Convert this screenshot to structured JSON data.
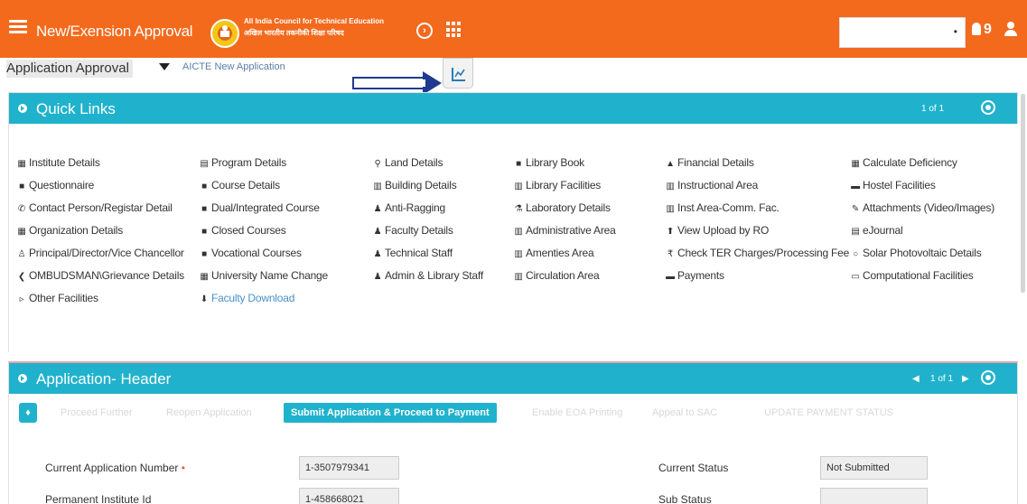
{
  "header": {
    "app_title": "New/Exension Approval",
    "org_name_en": "All India Council for Technical Education",
    "org_name_hi": "अखिल भारतीय तकनीकी शिक्षा परिषद",
    "notification_count": "9",
    "brand_color": "#f36a1d",
    "icons": [
      "menu-icon",
      "logo",
      "circle-arrow-icon",
      "apps-grid-icon",
      "bell-icon",
      "user-icon"
    ]
  },
  "breadcrumb": {
    "main": "Application Approval",
    "sub": "AICTE New Application"
  },
  "quick_links": {
    "title": "Quick Links",
    "pager": "1 of 1",
    "accent_color": "#20b2cc",
    "columns": [
      [
        {
          "label": "Institute Details",
          "icon": "▦"
        },
        {
          "label": "Questionnaire",
          "icon": "■"
        },
        {
          "label": "Contact Person/Registar Detail",
          "icon": "✆"
        },
        {
          "label": "Organization Details",
          "icon": "▦"
        },
        {
          "label": "Principal/Director/Vice Chancellor",
          "icon": "♙"
        },
        {
          "label": "OMBUDSMAN\\Grievance Details",
          "icon": "❮"
        },
        {
          "label": "Other Facilities",
          "icon": "▹"
        }
      ],
      [
        {
          "label": "Program Details",
          "icon": "▤"
        },
        {
          "label": "Course Details",
          "icon": "■"
        },
        {
          "label": "Dual/Integrated Course",
          "icon": "■"
        },
        {
          "label": "Closed Courses",
          "icon": "■"
        },
        {
          "label": "Vocational Courses",
          "icon": "■"
        },
        {
          "label": "University Name Change",
          "icon": "▦"
        },
        {
          "label": "Faculty Download",
          "icon": "⬇",
          "link": true
        }
      ],
      [
        {
          "label": "Land Details",
          "icon": "⚲"
        },
        {
          "label": "Building Details",
          "icon": "▥"
        },
        {
          "label": "Anti-Ragging",
          "icon": "♟"
        },
        {
          "label": "Faculty Details",
          "icon": "♟"
        },
        {
          "label": "Technical Staff",
          "icon": "♟"
        },
        {
          "label": "Admin & Library Staff",
          "icon": "♟"
        }
      ],
      [
        {
          "label": "Library Book",
          "icon": "■"
        },
        {
          "label": "Library Facilities",
          "icon": "▥"
        },
        {
          "label": "Laboratory Details",
          "icon": "⚗"
        },
        {
          "label": "Administrative Area",
          "icon": "▥"
        },
        {
          "label": "Amenties Area",
          "icon": "▥"
        },
        {
          "label": "Circulation Area",
          "icon": "▥"
        }
      ],
      [
        {
          "label": "Financial Details",
          "icon": "▲"
        },
        {
          "label": "Instructional Area",
          "icon": "▥"
        },
        {
          "label": "Inst Area-Comm. Fac.",
          "icon": "▥"
        },
        {
          "label": "View Upload by RO",
          "icon": "⬆"
        },
        {
          "label": "Check TER Charges/Processing Fee",
          "icon": "₹"
        },
        {
          "label": "Payments",
          "icon": "▬"
        }
      ],
      [
        {
          "label": "Calculate Deficiency",
          "icon": "▦"
        },
        {
          "label": "Hostel Facilities",
          "icon": "▬"
        },
        {
          "label": "Attachments (Video/Images)",
          "icon": "✎"
        },
        {
          "label": "eJournal",
          "icon": "▤"
        },
        {
          "label": "Solar Photovoltaic Details",
          "icon": "○"
        },
        {
          "label": "Computational Facilities",
          "icon": "▭"
        }
      ]
    ]
  },
  "application_header": {
    "title": "Application- Header",
    "pager": "1 of 1",
    "buttons": [
      {
        "label": "Proceed Further",
        "state": "disabled"
      },
      {
        "label": "Reopen Application",
        "state": "disabled"
      },
      {
        "label": "Submit Application & Proceed to Payment",
        "state": "active"
      },
      {
        "label": "Enable EOA Printing",
        "state": "disabled"
      },
      {
        "label": "Appeal to SAC",
        "state": "disabled"
      },
      {
        "label": "UPDATE PAYMENT STATUS",
        "state": "disabled"
      }
    ],
    "fields": {
      "current_app_label": "Current Application Number",
      "current_app_value": "1-3507979341",
      "permanent_id_label": "Permanent Institute Id",
      "permanent_id_value": "1-458668021",
      "current_status_label": "Current Status",
      "current_status_value": "Not Submitted",
      "sub_status_label": "Sub Status",
      "sub_status_value": ""
    }
  }
}
